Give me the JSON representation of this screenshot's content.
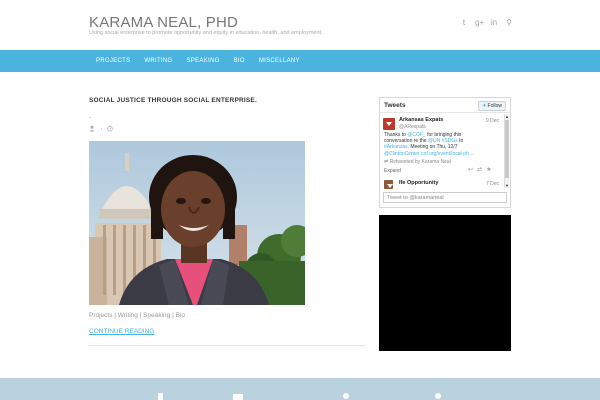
{
  "header": {
    "site_title": "KARAMA NEAL, PHD",
    "tagline": "Using social enterprise to promote opportunity and equity in education, health, and employment.",
    "social_icons": [
      "twitter-icon",
      "google-plus-icon",
      "linkedin-icon",
      "search-icon"
    ],
    "social_glyphs": [
      "t",
      "g+",
      "in",
      "⚲"
    ]
  },
  "nav": {
    "items": [
      "PROJECTS",
      "WRITING",
      "SPEAKING",
      "BIO",
      "MISCELLANY"
    ]
  },
  "post": {
    "title": "SOCIAL JUSTICE THROUGH SOCIAL ENTERPRISE.",
    "dot": ".",
    "categories": "Projects  |  Writing  |  Speaking  |  Bio",
    "continue_label": "CONTINUE READING"
  },
  "twitter": {
    "title": "Tweets",
    "follow_label": "Follow",
    "tweet1": {
      "name": "Arkansas Expats",
      "handle": "@ARexpats",
      "date": "9 Dec",
      "text_parts": [
        "Thanks to ",
        "@COF_",
        " for bringing this conversation re the ",
        "@UN",
        " ",
        "#SDGs",
        " to ",
        "#Arkansas",
        ". Meeting on Thu, 12/7 ",
        "@ClintonCenter",
        " ",
        "cof.org/event/local-ph…"
      ],
      "retweeted_by": "Retweeted by Karama Neal",
      "expand_label": "Expand"
    },
    "tweet2": {
      "name": "Ife Opportunity",
      "date": "7 Dec"
    },
    "input_placeholder": "Tweet to @karamaneal"
  },
  "colors": {
    "accent": "#4ab3de",
    "footer": "#b9d2dd"
  }
}
